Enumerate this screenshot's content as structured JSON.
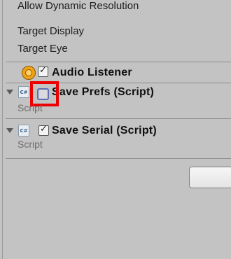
{
  "inspector": {
    "properties": [
      {
        "label": "Allow Dynamic Resolution"
      },
      {
        "label": "Target Display"
      },
      {
        "label": "Target Eye"
      }
    ],
    "components": {
      "audio_listener": {
        "title": "Audio Listener",
        "enabled": true,
        "icon": "audio-listener-icon"
      },
      "save_prefs": {
        "title": "Save Prefs (Script)",
        "enabled": false,
        "script_label": "Script",
        "icon": "csharp-script-icon",
        "expanded": true,
        "highlighted": true
      },
      "save_serial": {
        "title": "Save Serial (Script)",
        "enabled": true,
        "script_label": "Script",
        "icon": "csharp-script-icon",
        "expanded": true
      }
    },
    "button": {
      "label": ""
    }
  },
  "colors": {
    "highlight": "#ee0000",
    "audio_icon": "#f0a219"
  }
}
